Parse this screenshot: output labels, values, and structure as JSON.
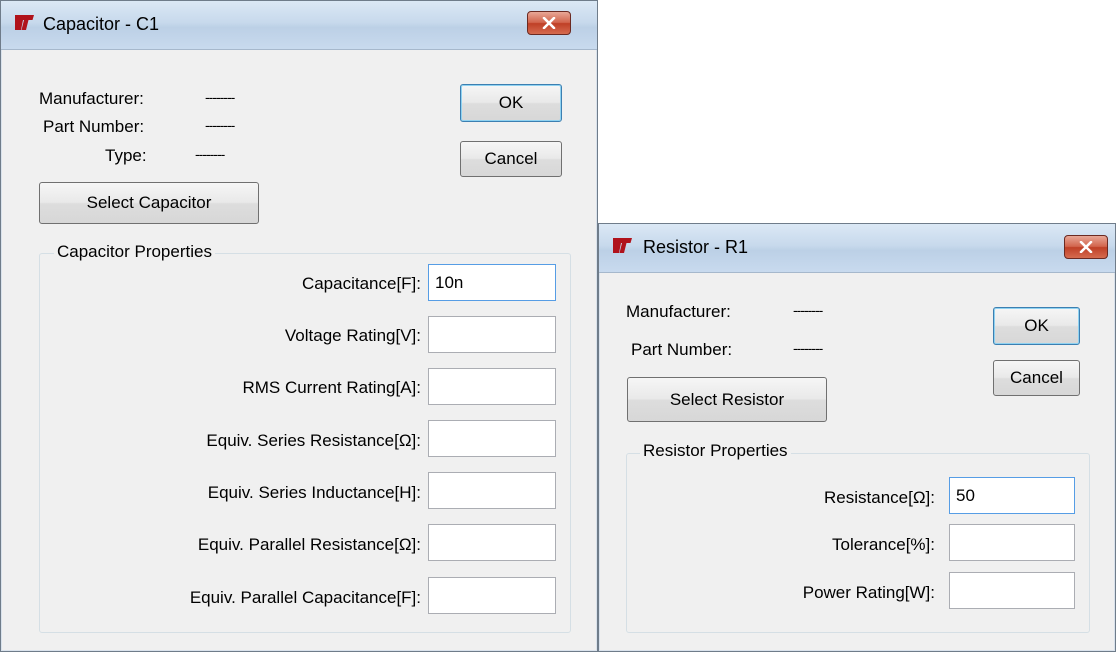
{
  "capacitor_dialog": {
    "title": "Capacitor - C1",
    "manufacturer_label": "Manufacturer:",
    "manufacturer_value": "--------",
    "part_number_label": "Part Number:",
    "part_number_value": "--------",
    "type_label": "Type:",
    "type_value": "--------",
    "ok_label": "OK",
    "cancel_label": "Cancel",
    "select_label": "Select Capacitor",
    "group_title": "Capacitor Properties",
    "fields": [
      {
        "label": "Capacitance[F]:",
        "value": "10n"
      },
      {
        "label": "Voltage Rating[V]:",
        "value": ""
      },
      {
        "label": "RMS Current Rating[A]:",
        "value": ""
      },
      {
        "label": "Equiv. Series Resistance[Ω]:",
        "value": ""
      },
      {
        "label": "Equiv. Series Inductance[H]:",
        "value": ""
      },
      {
        "label": "Equiv. Parallel Resistance[Ω]:",
        "value": ""
      },
      {
        "label": "Equiv. Parallel Capacitance[F]:",
        "value": ""
      }
    ]
  },
  "resistor_dialog": {
    "title": "Resistor - R1",
    "manufacturer_label": "Manufacturer:",
    "manufacturer_value": "--------",
    "part_number_label": "Part Number:",
    "part_number_value": "--------",
    "ok_label": "OK",
    "cancel_label": "Cancel",
    "select_label": "Select Resistor",
    "group_title": "Resistor Properties",
    "fields": [
      {
        "label": "Resistance[Ω]:",
        "value": "50"
      },
      {
        "label": "Tolerance[%]:",
        "value": ""
      },
      {
        "label": "Power Rating[W]:",
        "value": ""
      }
    ]
  },
  "icons": {
    "app_logo": "lt-logo-icon",
    "close": "close-icon"
  },
  "colors": {
    "close_button": "#c9452b",
    "logo": "#b0121b",
    "default_button_border": "#3c7fb1"
  }
}
